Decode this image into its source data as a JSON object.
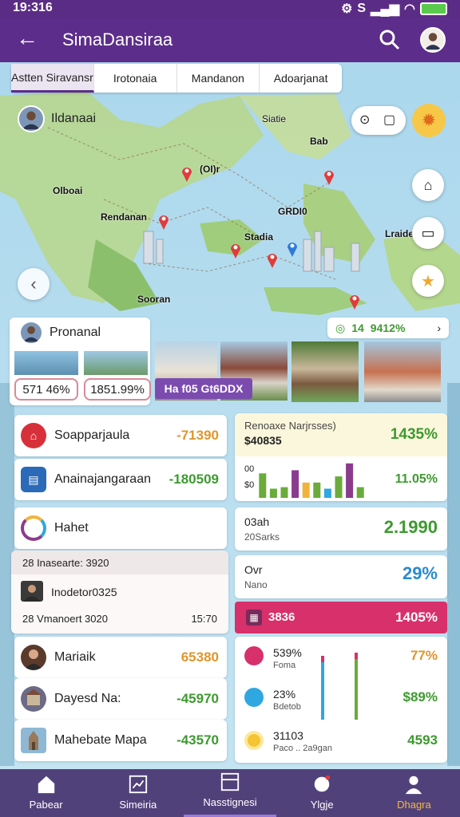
{
  "status_bar": {
    "time": "19:316",
    "indicators": "S"
  },
  "app_bar": {
    "title": "SimaDansiraa",
    "back_icon": "arrow-left-icon",
    "search_icon": "search-icon",
    "avatar": "profile-avatar"
  },
  "tabs": [
    {
      "label": "Astten Siravansr",
      "active": true
    },
    {
      "label": "Irotonaia",
      "active": false
    },
    {
      "label": "Mandanon",
      "active": false
    },
    {
      "label": "Adoarjanat",
      "active": false
    }
  ],
  "map": {
    "user_label": "Ildanaai",
    "labels": [
      "Siatie",
      "(OI)r",
      "Bab",
      "Olboai",
      "Rendanan",
      "GRDI0",
      "Stadia",
      "Lraide",
      "Sooran"
    ],
    "accent": "#e03b3b"
  },
  "card_pronanal": {
    "title": "Pronanal",
    "stat_right": "14",
    "stat_right_pct": "9412%",
    "pct_a": "571 46%",
    "pct_b": "1851.99%",
    "banner": "Ha f05 Gt6DDX"
  },
  "left_rows": [
    {
      "label": "Soapparjaula",
      "value": "-71390",
      "icon": "bank-icon",
      "color": "#e0962a"
    },
    {
      "label": "Anainajangaraan",
      "value": "-180509",
      "icon": "bus-icon",
      "color": "#3d9a2f"
    }
  ],
  "habit_card": {
    "label": "Hahet",
    "icon": "spinner-icon"
  },
  "detail_card": {
    "line1": "28 Inasearte: 3920",
    "person": "Inodetor0325",
    "line3": "28 Vmanoert 3020",
    "line3_right": "15:70"
  },
  "people_rows": [
    {
      "label": "Mariaik",
      "value": "65380",
      "color": "#e0962a"
    },
    {
      "label": "Dayesd Na:",
      "value": "-45970",
      "color": "#3d9a2f"
    },
    {
      "label": "Mahebate Mapa",
      "value": "-43570",
      "color": "#3d9a2f"
    }
  ],
  "revenue_panel": {
    "title": "Renoaxe Narjrsses)",
    "amount": "$40835",
    "pct": "1435%",
    "bottom_pct": "11.05%",
    "y_ticks": [
      "00",
      "$0"
    ]
  },
  "stat_card_1": {
    "label": "03ah",
    "sub": "20Sarks",
    "value": "2.1990"
  },
  "stat_card_2": {
    "label": "Ovr",
    "sub": "Nano",
    "value": "29%"
  },
  "highlight_bar": {
    "label": "3836",
    "value": "1405%",
    "color": "#d8306a"
  },
  "breakdown": [
    {
      "pct": "539%",
      "label": "Foma",
      "right": "77%",
      "color": "#d8306a",
      "right_color": "#e0962a"
    },
    {
      "pct": "23%",
      "label": "Bdetob",
      "right": "$89%",
      "color": "#2fa7e0",
      "right_color": "#3d9a2f"
    },
    {
      "pct": "31103",
      "label": "Paco .. 2a9gan",
      "right": "4593",
      "color": "#f4c533",
      "right_color": "#3d9a2f"
    }
  ],
  "chart_data": {
    "type": "bar",
    "categories": [
      "1",
      "2",
      "3",
      "4",
      "5",
      "6",
      "7",
      "8",
      "9",
      "10"
    ],
    "series": [
      {
        "values": [
          32,
          12,
          14,
          36,
          20,
          20,
          12,
          28,
          45,
          14
        ]
      }
    ],
    "colors": [
      "#6aab3a",
      "#6aab3a",
      "#6aab3a",
      "#8b3b8e",
      "#f0b43c",
      "#6aab3a",
      "#2fa7e0",
      "#6aab3a",
      "#8b3b8e",
      "#6aab3a"
    ],
    "ylim": [
      0,
      50
    ],
    "ytick_labels": [
      "00",
      "$0"
    ]
  },
  "nav": [
    {
      "label": "Pabear",
      "icon": "home-icon",
      "active": false
    },
    {
      "label": "Simeiria",
      "icon": "chart-icon",
      "active": false
    },
    {
      "label": "Nasstignesi",
      "icon": "folder-icon",
      "active": false
    },
    {
      "label": "Ylgje",
      "icon": "assistant-icon",
      "active": false
    },
    {
      "label": "Dhagra",
      "icon": "profile-icon",
      "active": true
    }
  ]
}
